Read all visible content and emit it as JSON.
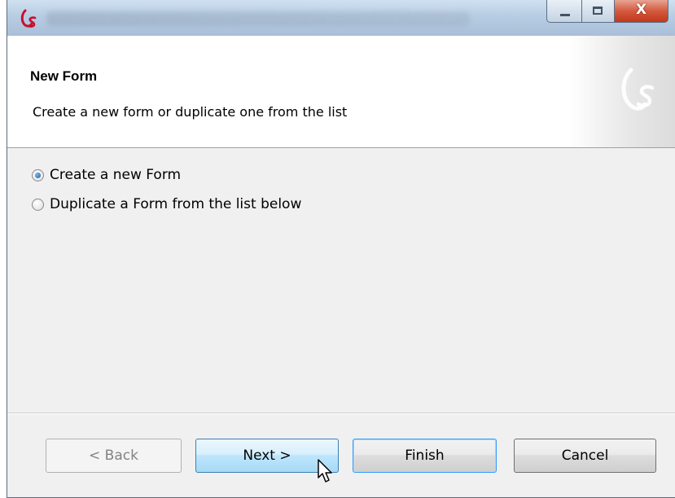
{
  "titlebar": {
    "icon": "app-logo-icon",
    "buttons": {
      "minimize": "minimize-icon",
      "maximize": "maximize-icon",
      "close_label": "X"
    }
  },
  "header": {
    "title": "New Form",
    "description": "Create a new form or duplicate one from the list",
    "logo": "app-watermark-logo-icon"
  },
  "options": [
    {
      "label": "Create a new Form",
      "checked": true
    },
    {
      "label": "Duplicate a Form from the list below",
      "checked": false
    }
  ],
  "buttons": {
    "back": "< Back",
    "next": "Next >",
    "finish": "Finish",
    "cancel": "Cancel"
  },
  "colors": {
    "accent": "#3399ff",
    "logo": "#c8102e",
    "close": "#c2371b"
  }
}
